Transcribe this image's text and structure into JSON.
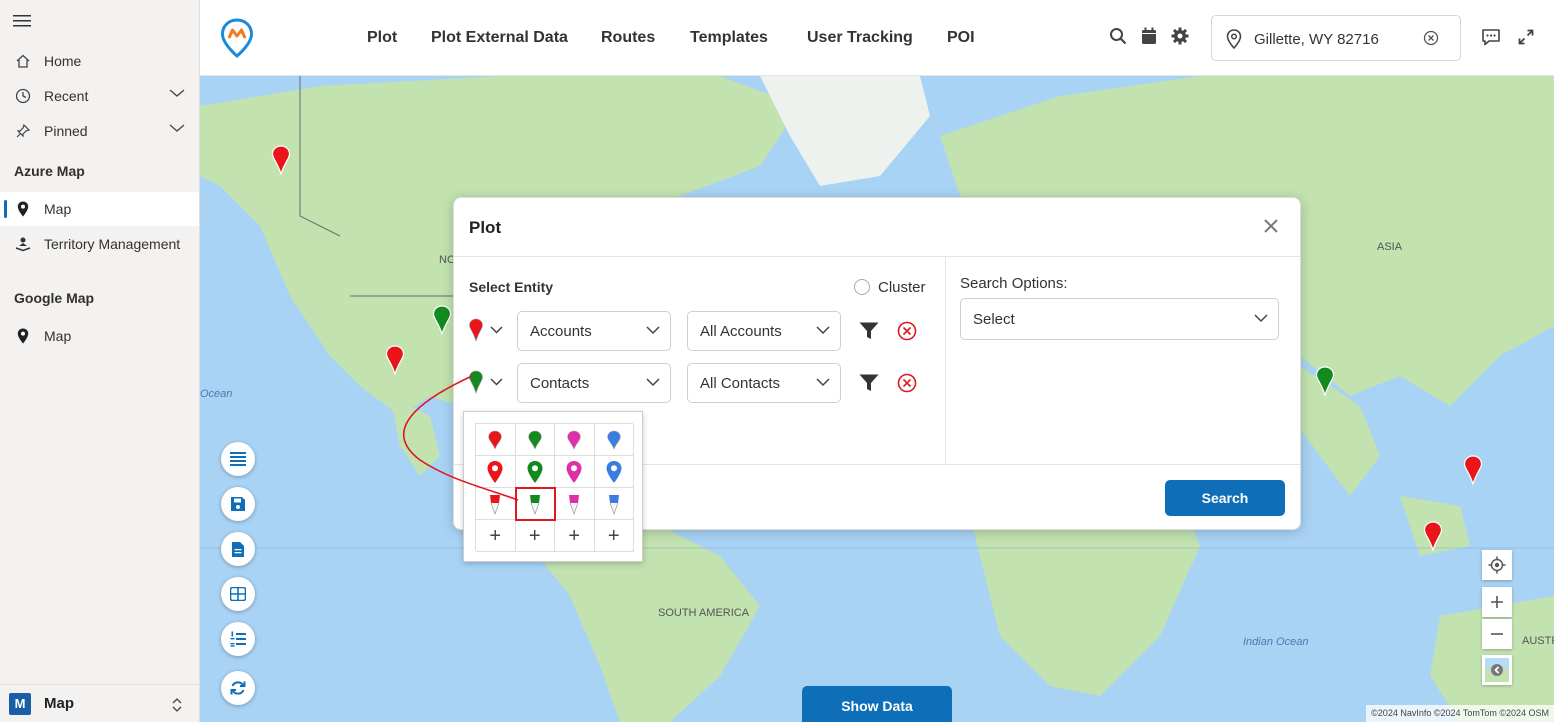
{
  "sidebar": {
    "items_top": [
      {
        "label": "Home",
        "icon": "home-icon"
      },
      {
        "label": "Recent",
        "icon": "clock-icon"
      },
      {
        "label": "Pinned",
        "icon": "pin-icon"
      }
    ],
    "sections": [
      {
        "title": "Azure Map",
        "items": [
          {
            "label": "Map",
            "icon": "map-marker-icon",
            "active": true
          },
          {
            "label": "Territory Management",
            "icon": "territory-icon",
            "active": false
          }
        ]
      },
      {
        "title": "Google Map",
        "items": [
          {
            "label": "Map",
            "icon": "map-marker-icon",
            "active": false
          }
        ]
      }
    ],
    "footer": {
      "badge": "M",
      "label": "Map"
    }
  },
  "topbar": {
    "menu": [
      "Plot",
      "Plot External Data",
      "Routes",
      "Templates",
      "User Tracking",
      "POI"
    ],
    "location": "Gillette, WY 82716"
  },
  "map": {
    "labels": [
      "NO",
      "ASIA",
      "SOUTH AMERICA"
    ],
    "ocean_labels": [
      "Ocean",
      "Indian Ocean"
    ],
    "edge_label": "AUSTR",
    "attribution": "©2024 NavInfo ©2024 TomTom ©2024 OSM",
    "show_data_label": "Show Data"
  },
  "dialog": {
    "title": "Plot",
    "select_entity_label": "Select Entity",
    "cluster_label": "Cluster",
    "rows": [
      {
        "pin_color": "#e8161b",
        "entity": "Accounts",
        "view": "All Accounts"
      },
      {
        "pin_color": "#138a1f",
        "entity": "Contacts",
        "view": "All Contacts"
      }
    ],
    "search_options_label": "Search Options:",
    "search_options_value": "Select",
    "search_button": "Search"
  },
  "picker": {
    "colors": [
      "#e8161b",
      "#138a1f",
      "#e030a8",
      "#3a7de0"
    ],
    "add_symbol": "+",
    "highlighted": {
      "row": 2,
      "col": 1
    }
  },
  "colors": {
    "accent": "#0e6eb8",
    "remove": "#e0181f"
  }
}
